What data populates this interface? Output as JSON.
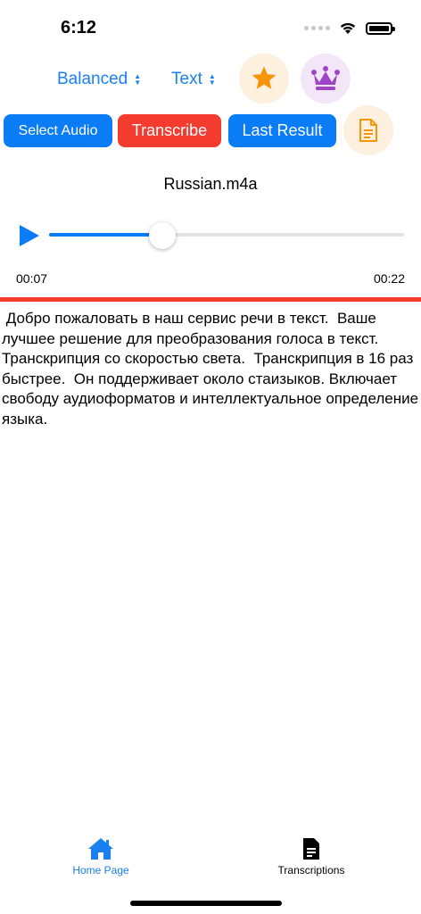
{
  "status_bar": {
    "time": "6:12"
  },
  "toolbar": {
    "quality_picker": "Balanced",
    "format_picker": "Text",
    "icons": {
      "favorite": "star-icon",
      "premium": "crown-icon",
      "export": "document-icon"
    }
  },
  "actions": {
    "select_audio": "Select Audio",
    "transcribe": "Transcribe",
    "last_result": "Last Result"
  },
  "player": {
    "file_name": "Russian.m4a",
    "current_time": "00:07",
    "total_time": "00:22",
    "progress": 0.32
  },
  "transcript": " Добро пожаловать в наш сервис речи в текст.  Ваше лучшее решение для преобразования голоса в текст. Транскрипция со скоростью света.  Транскрипция в 16 раз быстрее.  Он поддерживает около стаизыков. Включает свободу аудиоформатов и интеллектуальное определение языка.",
  "tab_bar": {
    "home": "Home Page",
    "transcriptions": "Transcriptions"
  },
  "colors": {
    "accent": "#0a7cf6",
    "danger": "#f33b30",
    "star": "#f7950a",
    "crown": "#a045c8"
  }
}
